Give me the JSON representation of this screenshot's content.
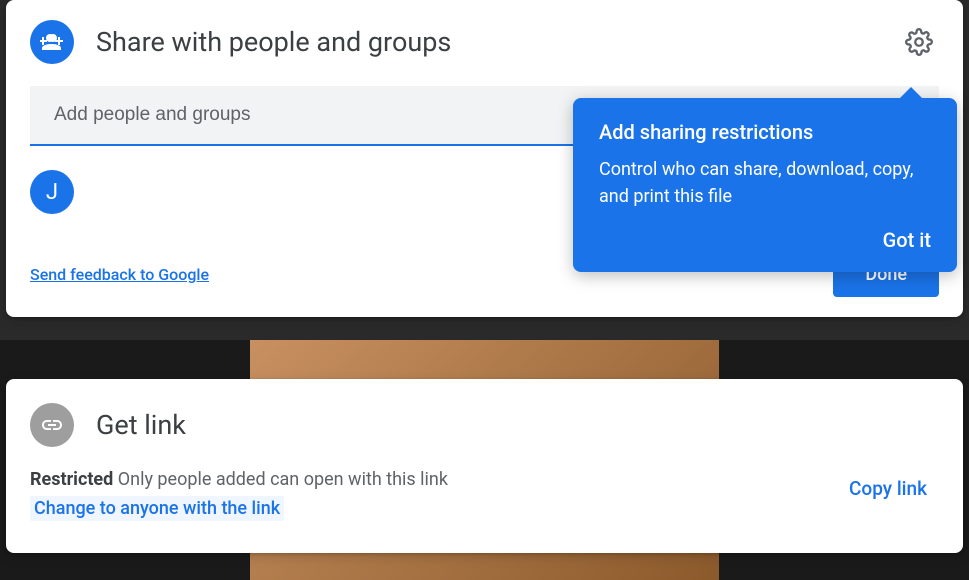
{
  "share": {
    "title": "Share with people and groups",
    "input_placeholder": "Add people and groups",
    "avatar_initial": "J",
    "feedback": "Send feedback to Google",
    "done": "Done"
  },
  "tooltip": {
    "title": "Add sharing restrictions",
    "body": "Control who can share, download, copy, and print this file",
    "action": "Got it"
  },
  "link": {
    "title": "Get link",
    "restricted_label": "Restricted",
    "restricted_desc": " Only people added can open with this link",
    "change": "Change to anyone with the link",
    "copy": "Copy link"
  }
}
